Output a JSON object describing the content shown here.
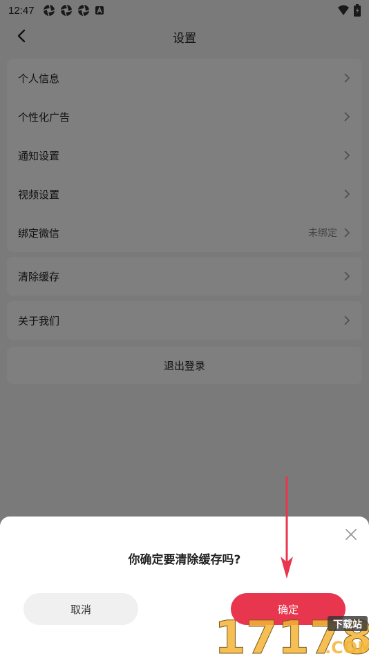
{
  "status_bar": {
    "time": "12:47",
    "icons": [
      "aperture-icon",
      "aperture-icon",
      "aperture-icon",
      "a-badge-icon"
    ],
    "right_icons": [
      "wifi-icon",
      "battery-icon"
    ]
  },
  "header": {
    "title": "设置",
    "back_icon": "chevron-left-icon"
  },
  "groups": [
    {
      "items": [
        {
          "label": "个人信息",
          "value": ""
        },
        {
          "label": "个性化广告",
          "value": ""
        },
        {
          "label": "通知设置",
          "value": ""
        },
        {
          "label": "视频设置",
          "value": ""
        },
        {
          "label": "绑定微信",
          "value": "未绑定"
        }
      ]
    },
    {
      "items": [
        {
          "label": "清除缓存",
          "value": ""
        }
      ]
    },
    {
      "items": [
        {
          "label": "关于我们",
          "value": ""
        }
      ]
    }
  ],
  "logout": {
    "label": "退出登录"
  },
  "dialog": {
    "title": "你确定要清除缓存吗?",
    "cancel_label": "取消",
    "confirm_label": "确定",
    "close_icon": "close-icon"
  },
  "watermark": {
    "number": "17178",
    "badge": "下载站",
    "domain": ".COM"
  },
  "colors": {
    "accent": "#e8364f",
    "overlay": "rgba(0,0,0,0.5)",
    "annotation": "#e8364f",
    "background": "#f4f4f4"
  }
}
